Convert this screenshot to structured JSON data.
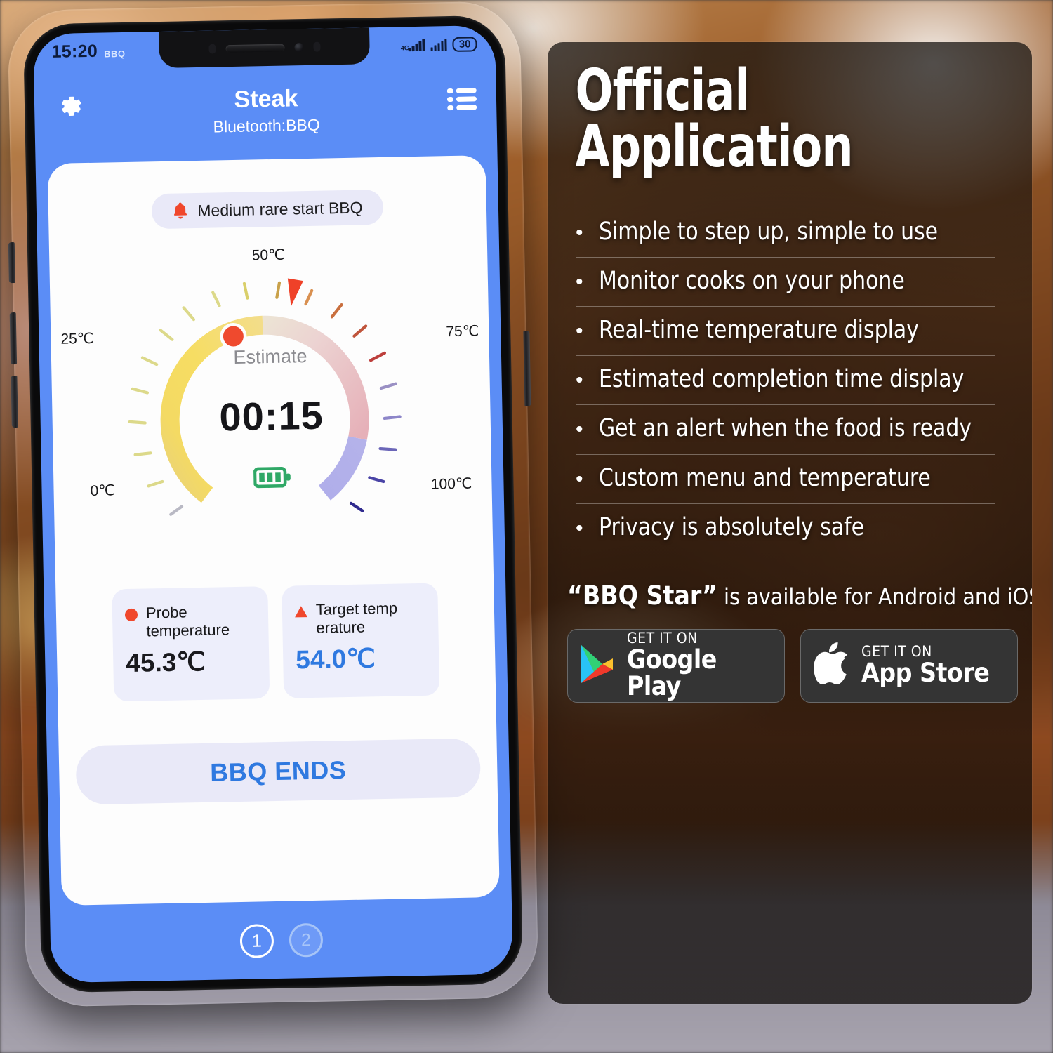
{
  "background": {
    "description": "blurred photo of grilled meat on wooden board with probe thermometer"
  },
  "phone": {
    "status_bar": {
      "time": "15:20",
      "carrier": "BBQ",
      "network_label": "4G",
      "battery_level": "30",
      "signal_icon": "signal-bars-icon",
      "battery_icon": "battery-pill-icon"
    },
    "header": {
      "title": "Steak",
      "subtitle": "Bluetooth:BBQ",
      "settings_icon": "gear-icon",
      "menu_icon": "list-menu-icon"
    },
    "alert": {
      "icon": "bell-icon",
      "text": "Medium rare start BBQ"
    },
    "gauge": {
      "estimate_label": "Estimate",
      "estimate_time": "00:15",
      "battery_icon": "battery-green-icon",
      "tick_labels": [
        "0℃",
        "25℃",
        "50℃",
        "75℃",
        "100℃"
      ],
      "probe_marker_icon": "probe-dot-marker",
      "target_marker_icon": "target-triangle-marker"
    },
    "cards": [
      {
        "icon": "probe-dot-icon",
        "label": "Probe\ntemperature",
        "label_line1": "Probe",
        "label_line2": "temperature",
        "value": "45.3℃"
      },
      {
        "icon": "target-triangle-icon",
        "label": "Target temp\nerature",
        "label_line1": "Target temp",
        "label_line2": "erature",
        "value": "54.0℃"
      }
    ],
    "primary_button": "BBQ ENDS",
    "page_dots": [
      "1",
      "2"
    ],
    "colors": {
      "screen_blue": "#5b8df6",
      "card_white": "#fdfdfd",
      "chip_lavender": "#e9e9f8",
      "accent_blue": "#2f79e0",
      "accent_red": "#f0472c",
      "battery_green": "#2fa866"
    }
  },
  "promo": {
    "headline_line1": "Official",
    "headline_line2": "Application",
    "features": [
      "Simple to step up, simple to use",
      "Monitor cooks on your phone",
      "Real-time temperature display",
      "Estimated completion time display",
      "Get an alert when the food is ready",
      "Custom menu and temperature",
      "Privacy is absolutely safe"
    ],
    "bullet_glyph": "•",
    "availability_brand": "“BBQ Star”",
    "availability_rest": " is available for Android and iOS",
    "store_badges": [
      {
        "icon": "google-play-icon",
        "small": "GET IT ON",
        "big": "Google Play"
      },
      {
        "icon": "apple-icon",
        "small": "GET IT ON",
        "big": "App Store"
      }
    ]
  },
  "chart_data": {
    "type": "gauge",
    "title": "Estimate",
    "unit": "℃",
    "min": 0,
    "max": 100,
    "tick_labels": [
      "0℃",
      "25℃",
      "50℃",
      "75℃",
      "100℃"
    ],
    "probe_temperature": 45.3,
    "target_temperature": 54.0,
    "estimated_time_remaining": "00:15",
    "arc_segments": [
      {
        "from": 0,
        "to": 45,
        "color": "#f2d24b",
        "name": "current-progress-yellow"
      },
      {
        "from": 45,
        "to": 78,
        "color": "#e9b6bd",
        "name": "remaining-pink"
      },
      {
        "from": 78,
        "to": 100,
        "color": "#a9a9e8",
        "name": "overshoot-purple"
      }
    ],
    "grid": false,
    "legend": "none"
  }
}
